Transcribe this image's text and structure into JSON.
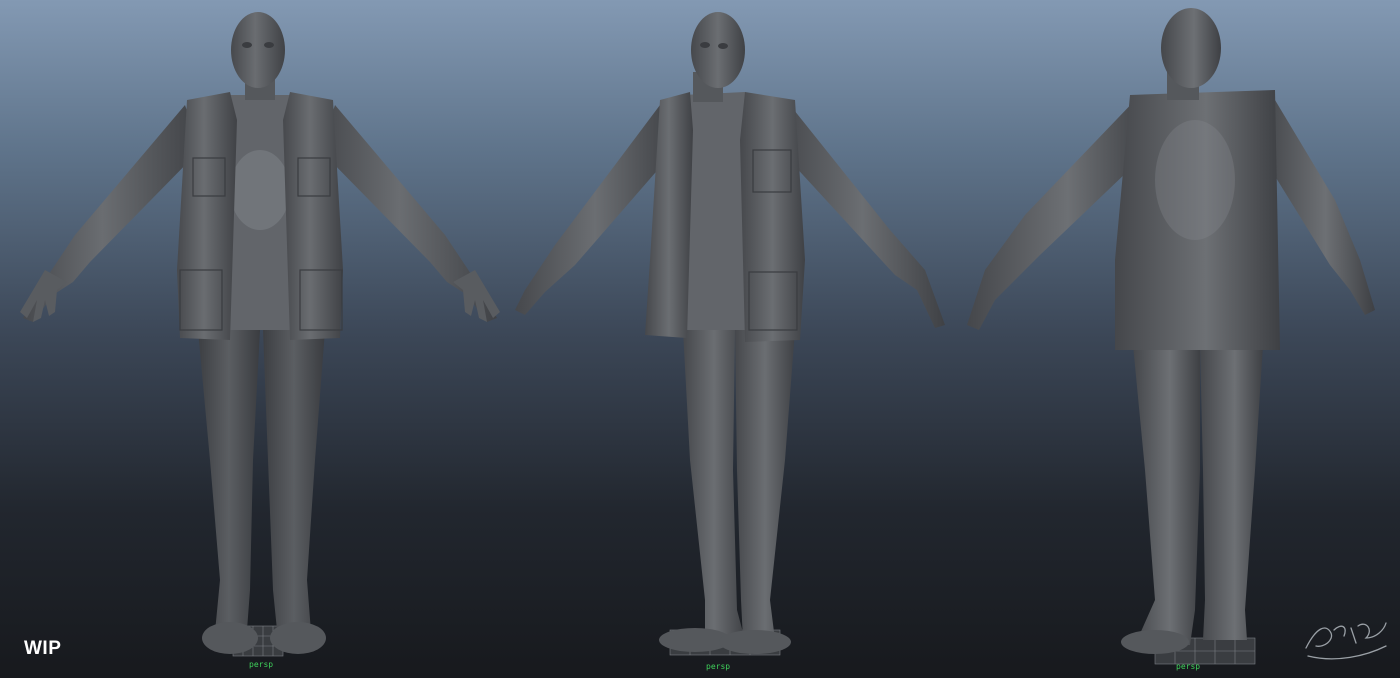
{
  "viewport": {
    "background_top": "#8399b3",
    "background_bottom": "#17191d",
    "camera_label": "persp",
    "camera_label_color": "#3fcf5a"
  },
  "views": [
    {
      "name": "front"
    },
    {
      "name": "three-quarter"
    },
    {
      "name": "back"
    }
  ],
  "overlay": {
    "status_text": "WIP"
  },
  "model": {
    "material_color": "#5a5d61",
    "highlight_color": "#8f9397"
  }
}
